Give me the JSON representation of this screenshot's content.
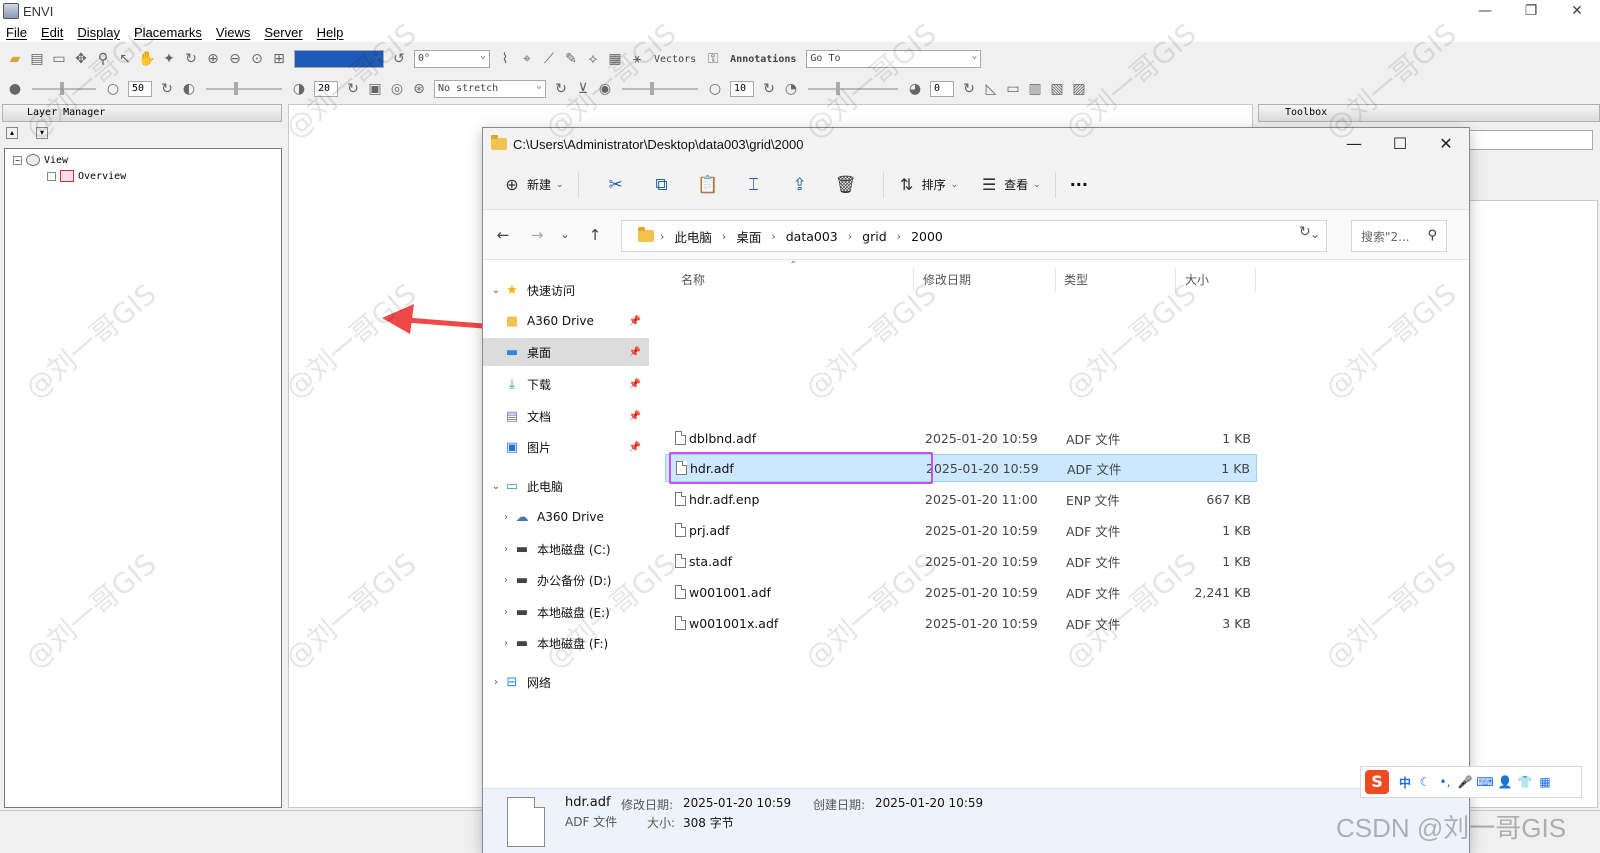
{
  "envi": {
    "title": "ENVI",
    "window_controls": {
      "minimize": "—",
      "restore": "❐",
      "close": "✕"
    },
    "menu": [
      "File",
      "Edit",
      "Display",
      "Placemarks",
      "Views",
      "Server",
      "Help"
    ],
    "toolbar": {
      "rotation_value": "0°",
      "vectors_label": "Vectors",
      "annotations_label": "Annotations",
      "goto_placeholder": "Go To",
      "brightness_value": "50",
      "contrast_value": "20",
      "stretch_value": "No stretch",
      "sharpen_value": "10",
      "transparency_value": "0"
    },
    "layer_manager": {
      "title": "Layer Manager",
      "tree": [
        {
          "label": "View",
          "expander": "−"
        },
        {
          "label": "Overview"
        }
      ]
    },
    "toolbox": {
      "title": "Toolbox"
    }
  },
  "explorer": {
    "title_path": "C:\\Users\\Administrator\\Desktop\\data003\\grid\\2000",
    "window_controls": {
      "minimize": "—",
      "maximize": "☐",
      "close": "✕"
    },
    "commands": {
      "new_label": "新建",
      "sort_label": "排序",
      "view_label": "查看",
      "more_label": "···"
    },
    "breadcrumbs": [
      "此电脑",
      "桌面",
      "data003",
      "grid",
      "2000"
    ],
    "search_placeholder": "搜索\"2...",
    "nav": {
      "quick_access": "快速访问",
      "a360_drive_pinned": "A360 Drive",
      "desktop": "桌面",
      "downloads": "下载",
      "documents": "文档",
      "pictures": "图片",
      "this_pc": "此电脑",
      "a360_drive": "A360 Drive",
      "drive_c": "本地磁盘 (C:)",
      "drive_d": "办公备份 (D:)",
      "drive_e": "本地磁盘 (E:)",
      "drive_f": "本地磁盘 (F:)",
      "network": "网络"
    },
    "columns": {
      "name": "名称",
      "modified": "修改日期",
      "type": "类型",
      "size": "大小"
    },
    "files": [
      {
        "name": "dblbnd.adf",
        "modified": "2025-01-20 10:59",
        "type": "ADF 文件",
        "size": "1 KB"
      },
      {
        "name": "hdr.adf",
        "modified": "2025-01-20 10:59",
        "type": "ADF 文件",
        "size": "1 KB"
      },
      {
        "name": "hdr.adf.enp",
        "modified": "2025-01-20 11:00",
        "type": "ENP 文件",
        "size": "667 KB"
      },
      {
        "name": "prj.adf",
        "modified": "2025-01-20 10:59",
        "type": "ADF 文件",
        "size": "1 KB"
      },
      {
        "name": "sta.adf",
        "modified": "2025-01-20 10:59",
        "type": "ADF 文件",
        "size": "1 KB"
      },
      {
        "name": "w001001.adf",
        "modified": "2025-01-20 10:59",
        "type": "ADF 文件",
        "size": "2,241 KB"
      },
      {
        "name": "w001001x.adf",
        "modified": "2025-01-20 10:59",
        "type": "ADF 文件",
        "size": "3 KB"
      }
    ],
    "details": {
      "name": "hdr.adf",
      "type": "ADF 文件",
      "modified_label": "修改日期:",
      "modified_value": "2025-01-20 10:59",
      "created_label": "创建日期:",
      "created_value": "2025-01-20 10:59",
      "size_label": "大小:",
      "size_value": "308 字节"
    }
  },
  "ime": {
    "logo": "S",
    "mode": "中"
  },
  "watermark": {
    "text": "@刘一哥GIS",
    "csdn": "CSDN @刘一哥GIS"
  },
  "colors": {
    "highlight_border": "#c84ef0",
    "arrow": "#f04848",
    "selection": "#cce8ff"
  }
}
